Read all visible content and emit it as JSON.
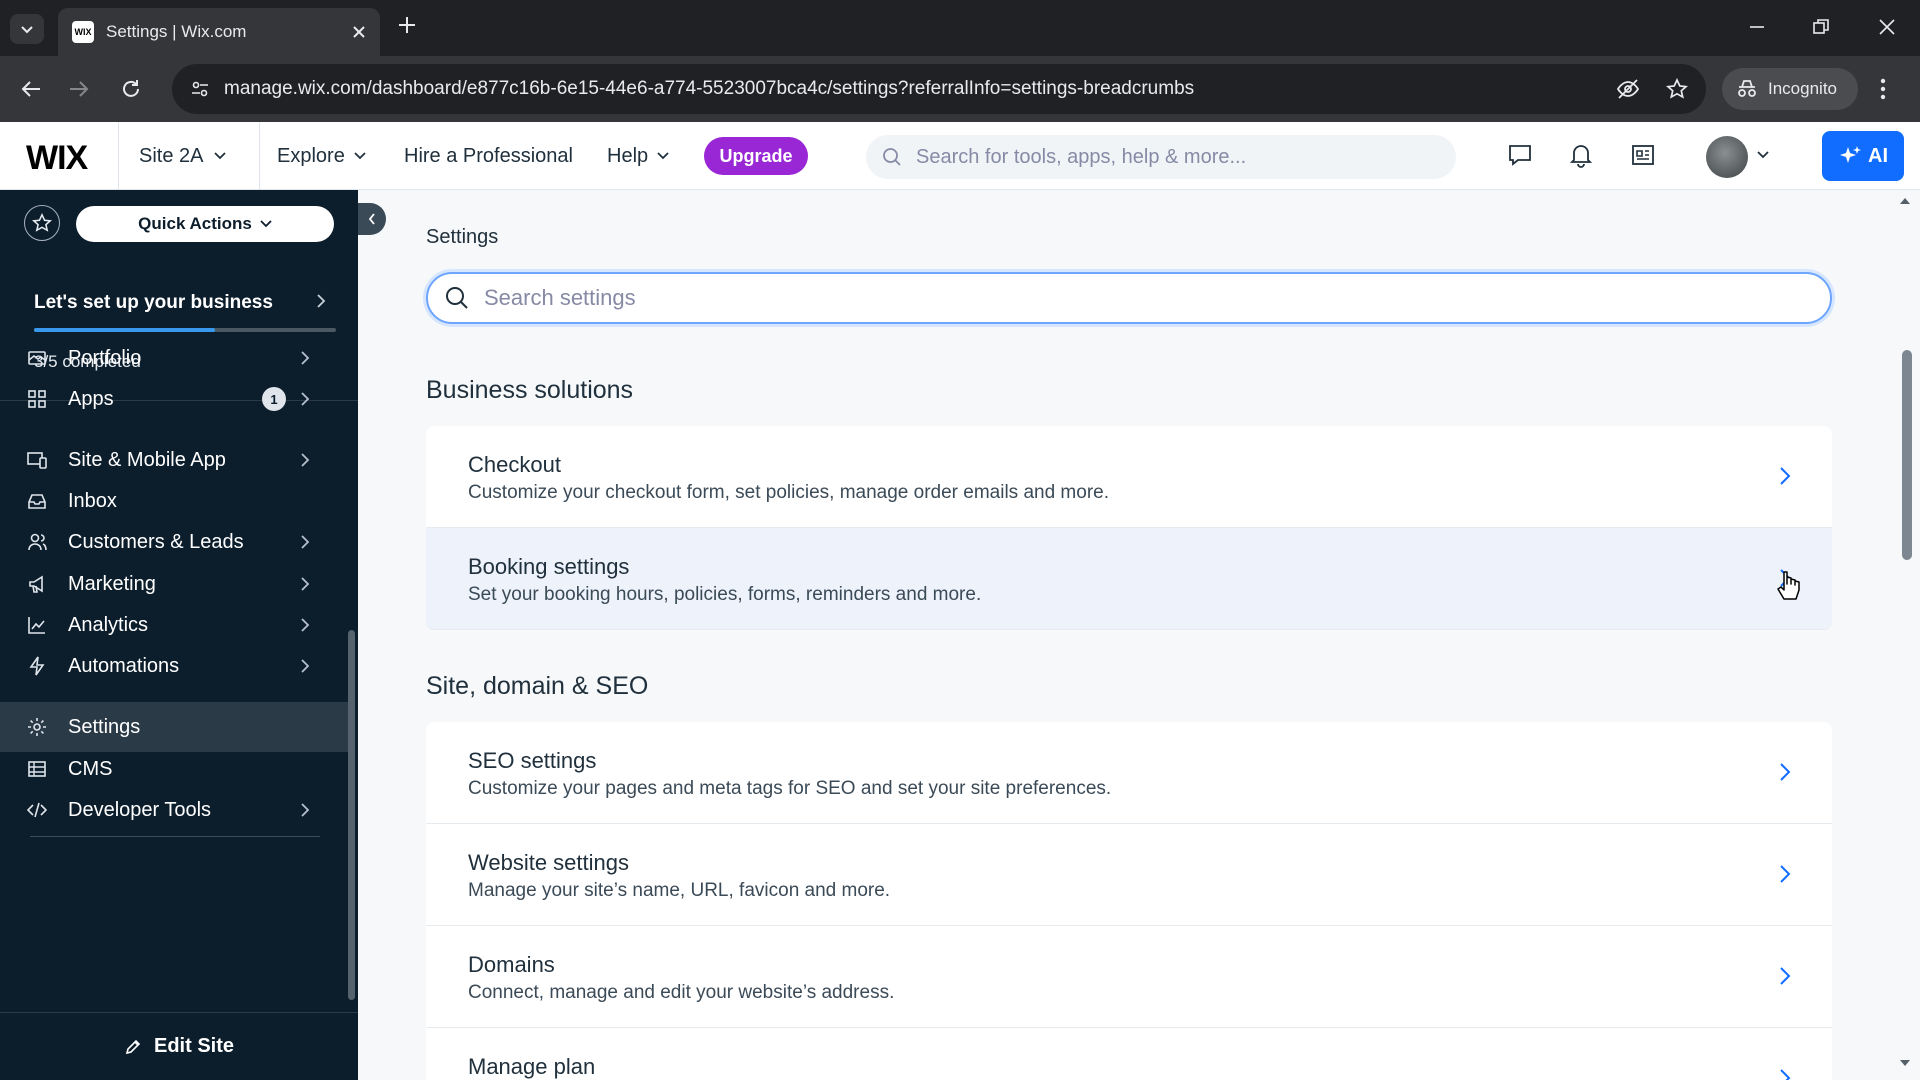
{
  "browser": {
    "tab_title": "Settings | Wix.com",
    "favicon_text": "WIX",
    "url": "manage.wix.com/dashboard/e877c16b-6e15-44e6-a774-5523007bca4c/settings?referralInfo=settings-breadcrumbs",
    "incognito_label": "Incognito"
  },
  "topbar": {
    "logo": "WIX",
    "site_name": "Site 2A",
    "explore": "Explore",
    "hire": "Hire a Professional",
    "help": "Help",
    "upgrade": "Upgrade",
    "search_placeholder": "Search for tools, apps, help & more...",
    "ai_label": "AI"
  },
  "sidebar": {
    "quick_actions": "Quick Actions",
    "setup_title": "Let's set up your business",
    "setup_progress": 0.6,
    "setup_count": "3/5 completed",
    "items": [
      {
        "label": "Portfolio",
        "icon": "portfolio-icon",
        "chevron": true
      },
      {
        "label": "Apps",
        "icon": "apps-icon",
        "badge": "1",
        "chevron": true
      },
      {
        "label": "Site & Mobile App",
        "icon": "site-mobile-icon",
        "chevron": true
      },
      {
        "label": "Inbox",
        "icon": "inbox-icon",
        "chevron": false
      },
      {
        "label": "Customers & Leads",
        "icon": "customers-icon",
        "chevron": true
      },
      {
        "label": "Marketing",
        "icon": "megaphone-icon",
        "chevron": true
      },
      {
        "label": "Analytics",
        "icon": "analytics-icon",
        "chevron": true
      },
      {
        "label": "Automations",
        "icon": "lightning-icon",
        "chevron": true
      },
      {
        "label": "Settings",
        "icon": "gear-icon",
        "chevron": false,
        "active": true
      },
      {
        "label": "CMS",
        "icon": "cms-icon",
        "chevron": false
      },
      {
        "label": "Developer Tools",
        "icon": "code-icon",
        "chevron": true
      }
    ],
    "edit_site": "Edit Site"
  },
  "main": {
    "breadcrumb": "Settings",
    "search_placeholder": "Search settings",
    "sections": [
      {
        "title": "Business solutions",
        "cards": [
          {
            "title": "Checkout",
            "desc": "Customize your checkout form, set policies, manage order emails and more."
          },
          {
            "title": "Booking settings",
            "desc": "Set your booking hours, policies, forms, reminders and more."
          }
        ]
      },
      {
        "title": "Site, domain & SEO",
        "cards": [
          {
            "title": "SEO settings",
            "desc": "Customize your pages and meta tags for SEO and set your site preferences."
          },
          {
            "title": "Website settings",
            "desc": "Manage your site’s name, URL, favicon and more."
          },
          {
            "title": "Domains",
            "desc": "Connect, manage and edit your website’s address."
          },
          {
            "title": "Manage plan",
            "desc": ""
          }
        ]
      }
    ]
  },
  "colors": {
    "sidebar_bg": "#0c1d2c",
    "accent": "#116dff",
    "upgrade": "#9a27d5",
    "progress": "#3899ec"
  }
}
